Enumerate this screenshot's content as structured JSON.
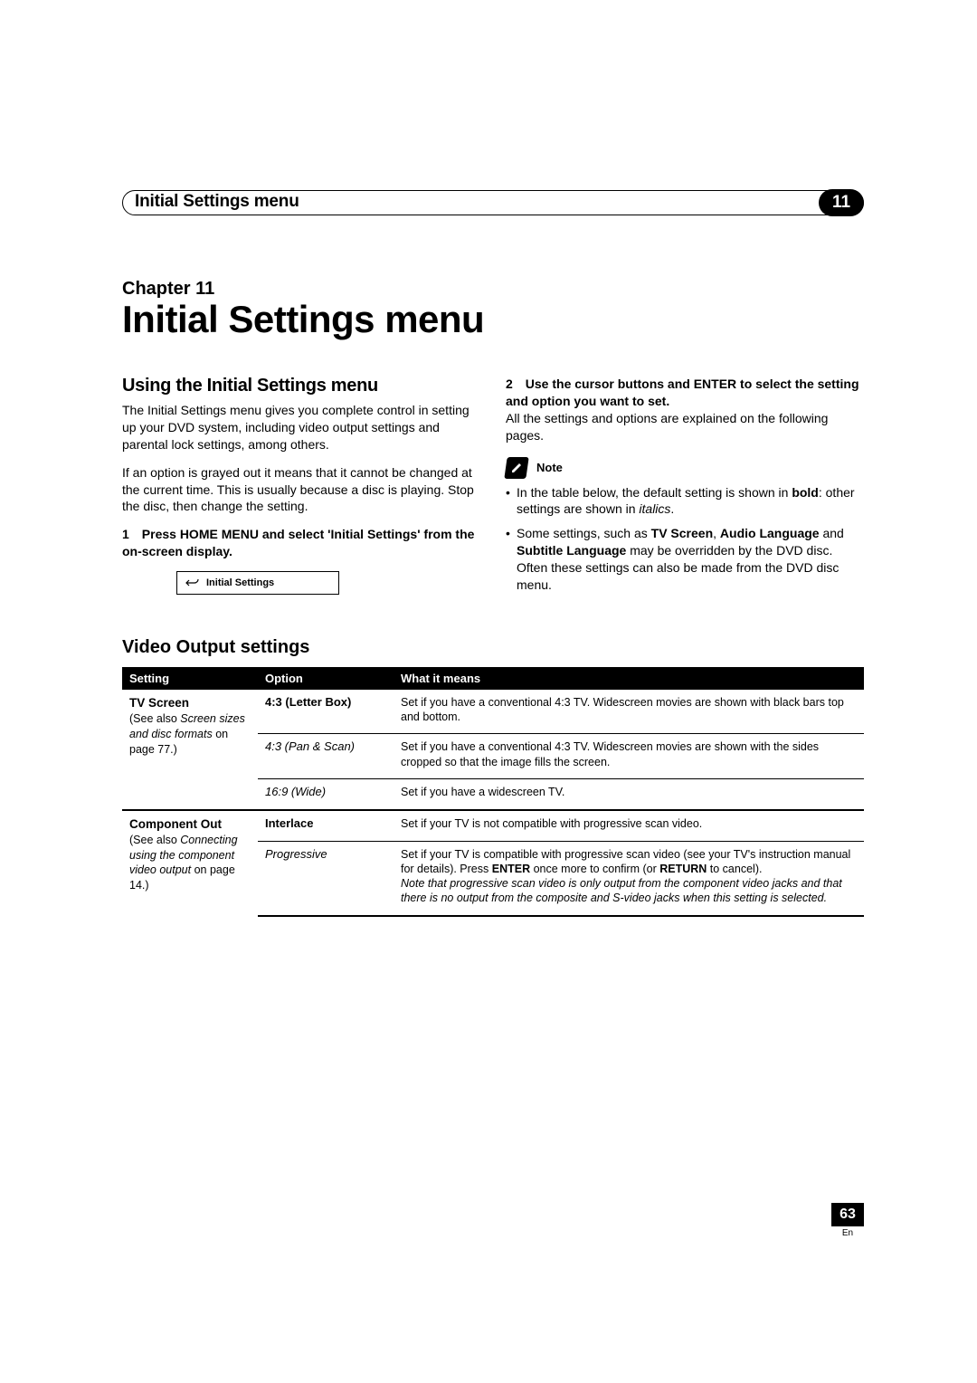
{
  "header": {
    "title": "Initial Settings menu",
    "chapter_number": "11"
  },
  "chapter": {
    "label": "Chapter 11",
    "title": "Initial Settings menu"
  },
  "left_col": {
    "subhead": "Using the Initial Settings menu",
    "para1": "The Initial Settings menu gives you complete control in setting up your DVD system, including video output settings and parental lock settings, among others.",
    "para2": "If an option is grayed out it means that it cannot be changed at the current time. This is usually because a disc is playing. Stop the disc, then change the setting.",
    "step1": "1 Press HOME MENU and select 'Initial Settings' from the on-screen display.",
    "ui_label": "Initial Settings"
  },
  "right_col": {
    "step2": "2 Use the cursor buttons and ENTER to select the setting and option you want to set.",
    "step2_after": "All the settings and options are explained on the following pages.",
    "note_label": "Note",
    "note1_pre": "In the table below, the default setting is shown in ",
    "note1_bold": "bold",
    "note1_mid": ": other settings are shown in ",
    "note1_italic": "italics",
    "note1_end": ".",
    "note2_pre": "Some settings, such as ",
    "note2_b1": "TV Screen",
    "note2_c1": ", ",
    "note2_b2": "Audio Language",
    "note2_c2": " and ",
    "note2_b3": "Subtitle Language",
    "note2_end": " may be overridden by the DVD disc. Often these settings can also be made from the DVD disc menu."
  },
  "table": {
    "section_title": "Video Output settings",
    "head_setting": "Setting",
    "head_option": "Option",
    "head_meaning": "What it means",
    "rows": {
      "tvscreen_name": "TV Screen",
      "tvscreen_ref1": "(See also ",
      "tvscreen_ref_i": "Screen sizes and disc formats",
      "tvscreen_ref2": " on page 77.)",
      "opt_43lb": "4:3 (Letter Box)",
      "mean_43lb": "Set if you have a conventional 4:3 TV. Widescreen movies are shown with black bars top and bottom.",
      "opt_43ps": "4:3 (Pan & Scan)",
      "mean_43ps": "Set if you have a conventional 4:3 TV. Widescreen movies are shown with the sides cropped so that the image fills the screen.",
      "opt_169": "16:9 (Wide)",
      "mean_169": "Set if you have a widescreen TV.",
      "comp_name": "Component Out",
      "comp_ref1": "(See also ",
      "comp_ref_i": "Connecting using the component video output",
      "comp_ref2": " on page 14.)",
      "opt_inter": "Interlace",
      "mean_inter": "Set if your TV is not compatible with progressive scan video.",
      "opt_prog": "Progressive",
      "mean_prog_pre": "Set if your TV is compatible with progressive scan video (see your TV's instruction manual for details). Press ",
      "mean_prog_b1": "ENTER",
      "mean_prog_mid": " once more to confirm (or ",
      "mean_prog_b2": "RETURN",
      "mean_prog_mid2": " to cancel).",
      "mean_prog_italic": "Note that progressive scan video is only output from the component video jacks and that there is no output from the composite and S-video jacks when this setting is selected."
    }
  },
  "footer": {
    "page": "63",
    "lang": "En"
  }
}
